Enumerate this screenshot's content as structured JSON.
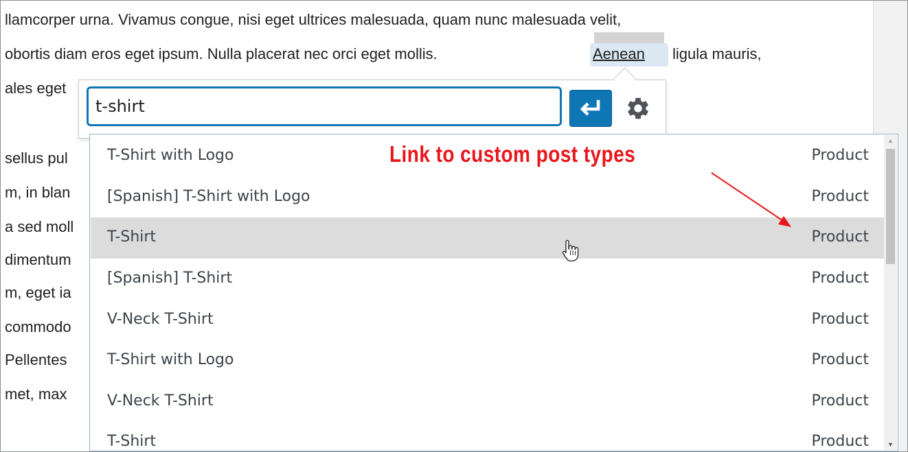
{
  "editor": {
    "lines": [
      "llamcorper urna. Vivamus congue, nisi eget ultrices malesuada, quam nunc malesuada velit,",
      "obortis diam eros eget ipsum. Nulla placerat nec orci eget mollis.",
      "ligula mauris,",
      "ales eget",
      "sellus pul",
      "m, in blan",
      "a sed moll",
      "dimentum",
      "m, eget ia",
      " commodo",
      " Pellentes",
      "met, max"
    ],
    "linked_word": "Aenean"
  },
  "link_popup": {
    "url_value": "t-shirt",
    "apply_icon": "enter-arrow-icon",
    "settings_icon": "gear-icon"
  },
  "suggestions": [
    {
      "title": "T-Shirt with Logo",
      "type": "Product"
    },
    {
      "title": "[Spanish] T-Shirt with Logo",
      "type": "Product"
    },
    {
      "title": "T-Shirt",
      "type": "Product"
    },
    {
      "title": "[Spanish] T-Shirt",
      "type": "Product"
    },
    {
      "title": "V-Neck T-Shirt",
      "type": "Product"
    },
    {
      "title": "T-Shirt with Logo",
      "type": "Product"
    },
    {
      "title": "V-Neck T-Shirt",
      "type": "Product"
    },
    {
      "title": "T-Shirt",
      "type": "Product"
    }
  ],
  "annotation": {
    "text": "Link to custom post types",
    "color": "#e8161c"
  },
  "colors": {
    "accent": "#0e76b5",
    "hover_row": "#dcdcdc"
  }
}
